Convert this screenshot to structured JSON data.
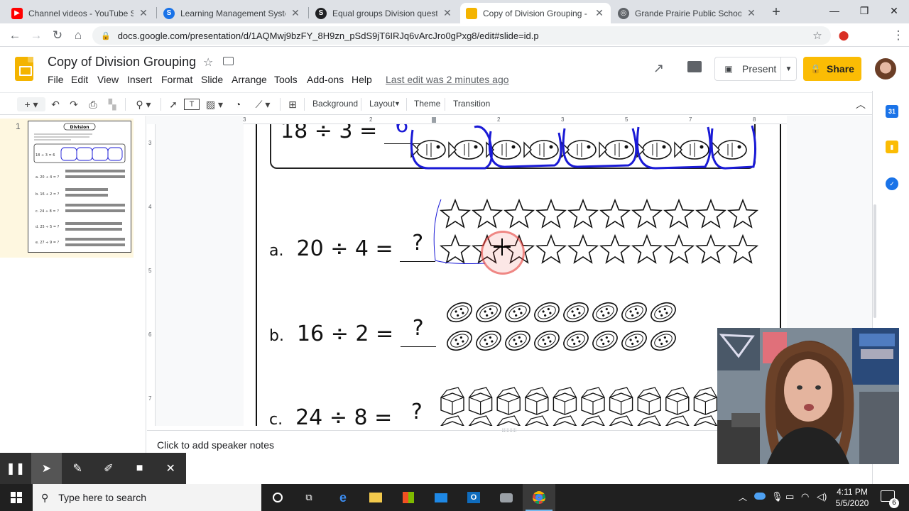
{
  "browser": {
    "tabs": [
      {
        "label": "Channel videos - YouTube Stud",
        "favicon": "youtube-icon",
        "color": "#ff0000"
      },
      {
        "label": "Learning Management System",
        "favicon": "school-icon",
        "color": "#1a73e8"
      },
      {
        "label": "Equal groups Division question",
        "favicon": "school-icon",
        "color": "#202124"
      },
      {
        "label": "Copy of Division Grouping - G",
        "favicon": "slides-icon",
        "color": "#f4b400"
      },
      {
        "label": "Grande Prairie Public School D",
        "favicon": "district-icon",
        "color": "#5f6368"
      }
    ],
    "url": "docs.google.com/presentation/d/1AQMwj9bzFY_8H9zn_pSdS9jT6IRJq6vArcJro0gPxg8/edit#slide=id.p"
  },
  "app": {
    "title": "Copy of Division Grouping",
    "menus": [
      "File",
      "Edit",
      "View",
      "Insert",
      "Format",
      "Slide",
      "Arrange",
      "Tools",
      "Add-ons",
      "Help"
    ],
    "last_edit": "Last edit was 2 minutes ago",
    "present_label": "Present",
    "share_label": "Share"
  },
  "toolbar": {
    "background": "Background",
    "layout": "Layout",
    "theme": "Theme",
    "transition": "Transition"
  },
  "filmstrip": {
    "slide_number": "1",
    "thumb_title": "Division"
  },
  "ruler": {
    "h_ticks": [
      "3",
      "2",
      "1",
      "1",
      "2",
      "3",
      "4",
      "5",
      "6",
      "7",
      "8"
    ],
    "v_ticks": [
      "3",
      "4",
      "5",
      "6",
      "7"
    ]
  },
  "slide": {
    "example": {
      "dividend": "18",
      "divisor": "3",
      "answer": "6"
    },
    "problems": [
      {
        "letter": "a.",
        "dividend": "20",
        "divisor": "4",
        "answer": "?",
        "item": "star",
        "count": 20
      },
      {
        "letter": "b.",
        "dividend": "16",
        "divisor": "2",
        "answer": "?",
        "item": "button",
        "count": 16
      },
      {
        "letter": "c.",
        "dividend": "24",
        "divisor": "8",
        "answer": "?",
        "item": "box",
        "count": 24
      }
    ],
    "div_sign": "÷",
    "eq_sign": "="
  },
  "notes": {
    "placeholder": "Click to add speaker notes"
  },
  "taskbar": {
    "search_placeholder": "Type here to search",
    "time": "4:11 PM",
    "date": "5/5/2020",
    "notif_count": "6"
  },
  "colors": {
    "ink_blue": "#1a1ad6",
    "slides_yellow": "#f4b400",
    "share_yellow": "#fbbc04",
    "cursor_red": "#e53935"
  }
}
